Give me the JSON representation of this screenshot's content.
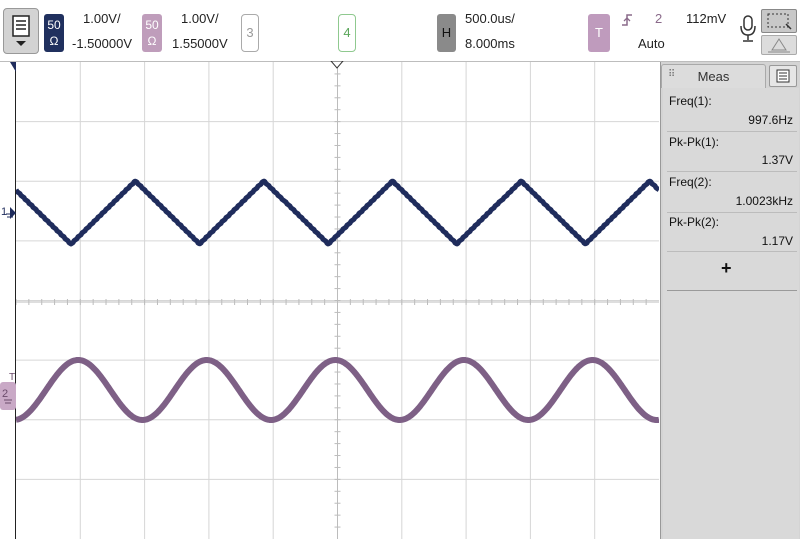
{
  "toolbar": {
    "ch1": {
      "imp_line1": "50",
      "imp_line2": "Ω",
      "scale": "1.00V/",
      "offset": "-1.50000V",
      "color": "#20305e"
    },
    "ch2": {
      "imp_line1": "50",
      "imp_line2": "Ω",
      "scale": "1.00V/",
      "offset": "1.55000V",
      "color": "#8a6a8a"
    },
    "ch3": {
      "label": "3"
    },
    "ch4": {
      "label": "4"
    },
    "horizontal": {
      "label": "H",
      "timebase": "500.0us/",
      "delay": "8.000ms"
    },
    "trigger": {
      "label": "T",
      "slope_icon": "rising-edge-icon",
      "source": "2",
      "level": "112mV",
      "mode": "Auto"
    },
    "icons": [
      "menu-icon",
      "microphone-icon",
      "zoom-box-icon",
      "delta-icon"
    ]
  },
  "scope": {
    "ch1_marker": "1",
    "ch2_marker": "2",
    "trigger_marker": "T"
  },
  "measurements": {
    "tab_label": "Meas",
    "items": [
      {
        "label": "Freq(1):",
        "value": "997.6Hz"
      },
      {
        "label": "Pk-Pk(1):",
        "value": "1.37V"
      },
      {
        "label": "Freq(2):",
        "value": "1.0023kHz"
      },
      {
        "label": "Pk-Pk(2):",
        "value": "1.17V"
      }
    ],
    "add_label": "+"
  }
}
